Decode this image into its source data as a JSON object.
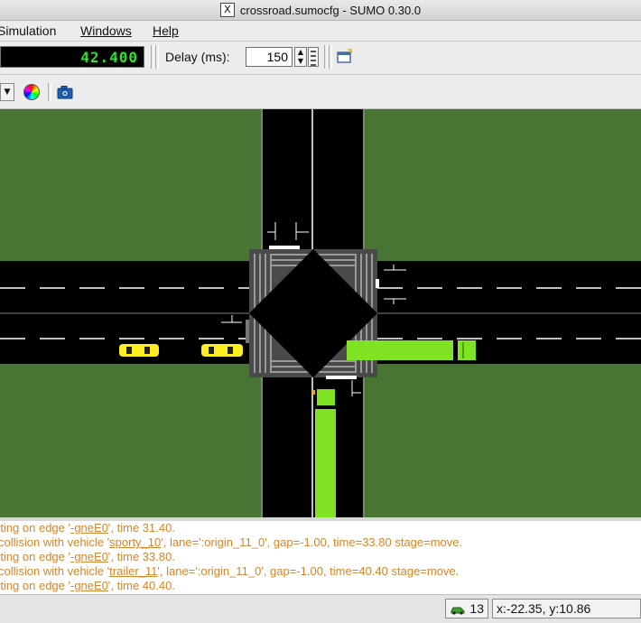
{
  "window": {
    "title": "crossroad.sumocfg - SUMO 0.30.0",
    "x_icon": "X"
  },
  "menu": {
    "simulation": "Simulation",
    "windows": "Windows",
    "help": "Help"
  },
  "toolbar": {
    "time_display": "42.400",
    "delay_label": "Delay (ms):",
    "delay_value": "150",
    "spinner_up": "▲",
    "spinner_down": "▼"
  },
  "toolbar2": {
    "dropdown_arrow": "▼"
  },
  "icons": {
    "close_x": "x-window-icon",
    "editor": "open-editor-icon",
    "color": "color-wheel-icon",
    "camera": "camera-icon",
    "vehicle": "car-icon"
  },
  "colors": {
    "grass": "#497534",
    "road": "#000000",
    "car_yellow": "#ffee22",
    "truck_green": "#7fe323",
    "log_text": "#d3852a",
    "time_green": "#2de12d"
  },
  "log": [
    {
      "before": "rting on edge '",
      "link": "-gneE0",
      "after": "', time 31.40."
    },
    {
      "before": "collision with vehicle '",
      "link": "sporty_10",
      "after": "', lane=':origin_11_0', gap=-1.00, time=33.80 stage=move."
    },
    {
      "before": "rting on edge '",
      "link": "-gneE0",
      "after": "', time 33.80."
    },
    {
      "before": "collision with vehicle '",
      "link": "trailer_11",
      "after": "', lane=':origin_11_0', gap=-1.00, time=40.40 stage=move."
    },
    {
      "before": "rting on edge '",
      "link": "-gneE0",
      "after": "', time 40.40."
    }
  ],
  "status": {
    "vehicle_count": "13",
    "coordinates": "x:-22.35, y:10.86"
  }
}
